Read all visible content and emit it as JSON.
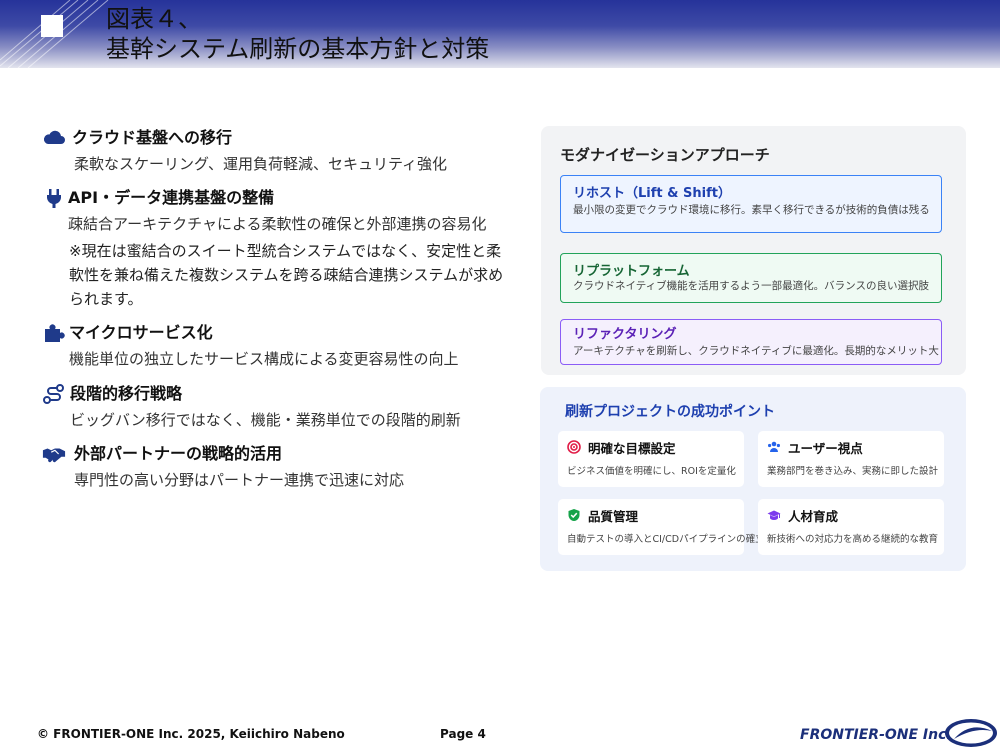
{
  "header": {
    "title_line1": "図表４、",
    "title_line2": "基幹システム刷新の基本方針と対策"
  },
  "left_items": [
    {
      "icon": "cloud-icon",
      "heading": "クラウド基盤への移行",
      "desc": "柔軟なスケーリング、運用負荷軽減、セキュリティ強化"
    },
    {
      "icon": "plug-icon",
      "heading": "API・データ連携基盤の整備",
      "desc": "疎結合アーキテクチャによる柔軟性の確保と外部連携の容易化",
      "note": "※現在は蜜結合のスイート型統合システムではなく、安定性と柔軟性を兼ね備えた複数システムを跨る疎結合連携システムが求められます。"
    },
    {
      "icon": "puzzle-icon",
      "heading": "マイクロサービス化",
      "desc": "機能単位の独立したサービス構成による変更容易性の向上"
    },
    {
      "icon": "route-icon",
      "heading": "段階的移行戦略",
      "desc": "ビッグバン移行ではなく、機能・業務単位での段階的刷新"
    },
    {
      "icon": "handshake-icon",
      "heading": "外部パートナーの戦略的活用",
      "desc": "専門性の高い分野はパートナー連携で迅速に対応"
    }
  ],
  "modernization": {
    "title": "モダナイゼーションアプローチ",
    "cards": [
      {
        "title": "リホスト（Lift & Shift）",
        "desc": "最小限の変更でクラウド環境に移行。素早く移行できるが技術的負債は残る",
        "color": "#3b82f6"
      },
      {
        "title": "リプラットフォーム",
        "desc": "クラウドネイティブ機能を活用するよう一部最適化。バランスの良い選択肢",
        "color": "#22a35a"
      },
      {
        "title": "リファクタリング",
        "desc": "アーキテクチャを刷新し、クラウドネイティブに最適化。長期的なメリット大",
        "color": "#8b5cf6"
      }
    ]
  },
  "success": {
    "title": "刷新プロジェクトの成功ポイント",
    "points": [
      {
        "icon": "target-icon",
        "title": "明確な目標設定",
        "desc": "ビジネス価値を明確にし、ROIを定量化"
      },
      {
        "icon": "users-icon",
        "title": "ユーザー視点",
        "desc": "業務部門を巻き込み、実務に即した設計"
      },
      {
        "icon": "shield-check-icon",
        "title": "品質管理",
        "desc": "自動テストの導入とCI/CDパイプラインの確立"
      },
      {
        "icon": "graduation-cap-icon",
        "title": "人材育成",
        "desc": "新技術への対応力を高める継続的な教育"
      }
    ]
  },
  "footer": {
    "copyright": "© FRONTIER-ONE Inc. 2025,  Keiichiro  Nabeno",
    "page": "Page 4",
    "logo_text": "FRONTIER-ONE Inc."
  }
}
